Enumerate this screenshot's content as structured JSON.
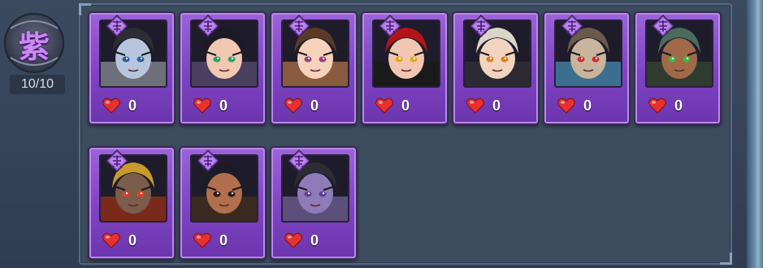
{
  "rank": {
    "badge_glyph": "紫",
    "count_label": "10/10"
  },
  "heroes": [
    {
      "id": "hero-1",
      "likes": "0",
      "hair": "#2d2d35",
      "skin": "#b7c6dd",
      "accent": "#6d6f7a",
      "eyes": "#2b5fa3"
    },
    {
      "id": "hero-2",
      "likes": "0",
      "hair": "#1b1b24",
      "skin": "#f1c8b0",
      "accent": "#4a3f5e",
      "eyes": "#26a169"
    },
    {
      "id": "hero-3",
      "likes": "0",
      "hair": "#5a3a26",
      "skin": "#f6d2bd",
      "accent": "#8a5a3e",
      "eyes": "#9a3d7e"
    },
    {
      "id": "hero-4",
      "likes": "0",
      "hair": "#b3141a",
      "skin": "#f2c7b2",
      "accent": "#1a1a1a",
      "eyes": "#e4a915"
    },
    {
      "id": "hero-5",
      "likes": "0",
      "hair": "#d9d6c8",
      "skin": "#f1d4c0",
      "accent": "#2d2a33",
      "eyes": "#e47a17"
    },
    {
      "id": "hero-6",
      "likes": "0",
      "hair": "#6a5a4a",
      "skin": "#c9b49d",
      "accent": "#3c6f8f",
      "eyes": "#d22b2b"
    },
    {
      "id": "hero-7",
      "likes": "0",
      "hair": "#4a6b5a",
      "skin": "#a06a4a",
      "accent": "#2f3b2f",
      "eyes": "#35c13c"
    },
    {
      "id": "hero-8",
      "likes": "0",
      "hair": "#c89a2a",
      "skin": "#7a5d4a",
      "accent": "#7a2a1a",
      "eyes": "#e53a2a"
    },
    {
      "id": "hero-9",
      "likes": "0",
      "hair": "#1c1c26",
      "skin": "#b0704e",
      "accent": "#3a2a1f",
      "eyes": "#2a1a14"
    },
    {
      "id": "hero-10",
      "likes": "0",
      "hair": "#2d2d35",
      "skin": "#8e7bb7",
      "accent": "#5c4f7a",
      "eyes": "#5e3f9f"
    }
  ],
  "colors": {
    "card_purple": "#8a52cf",
    "heart_red": "#e8302f"
  }
}
